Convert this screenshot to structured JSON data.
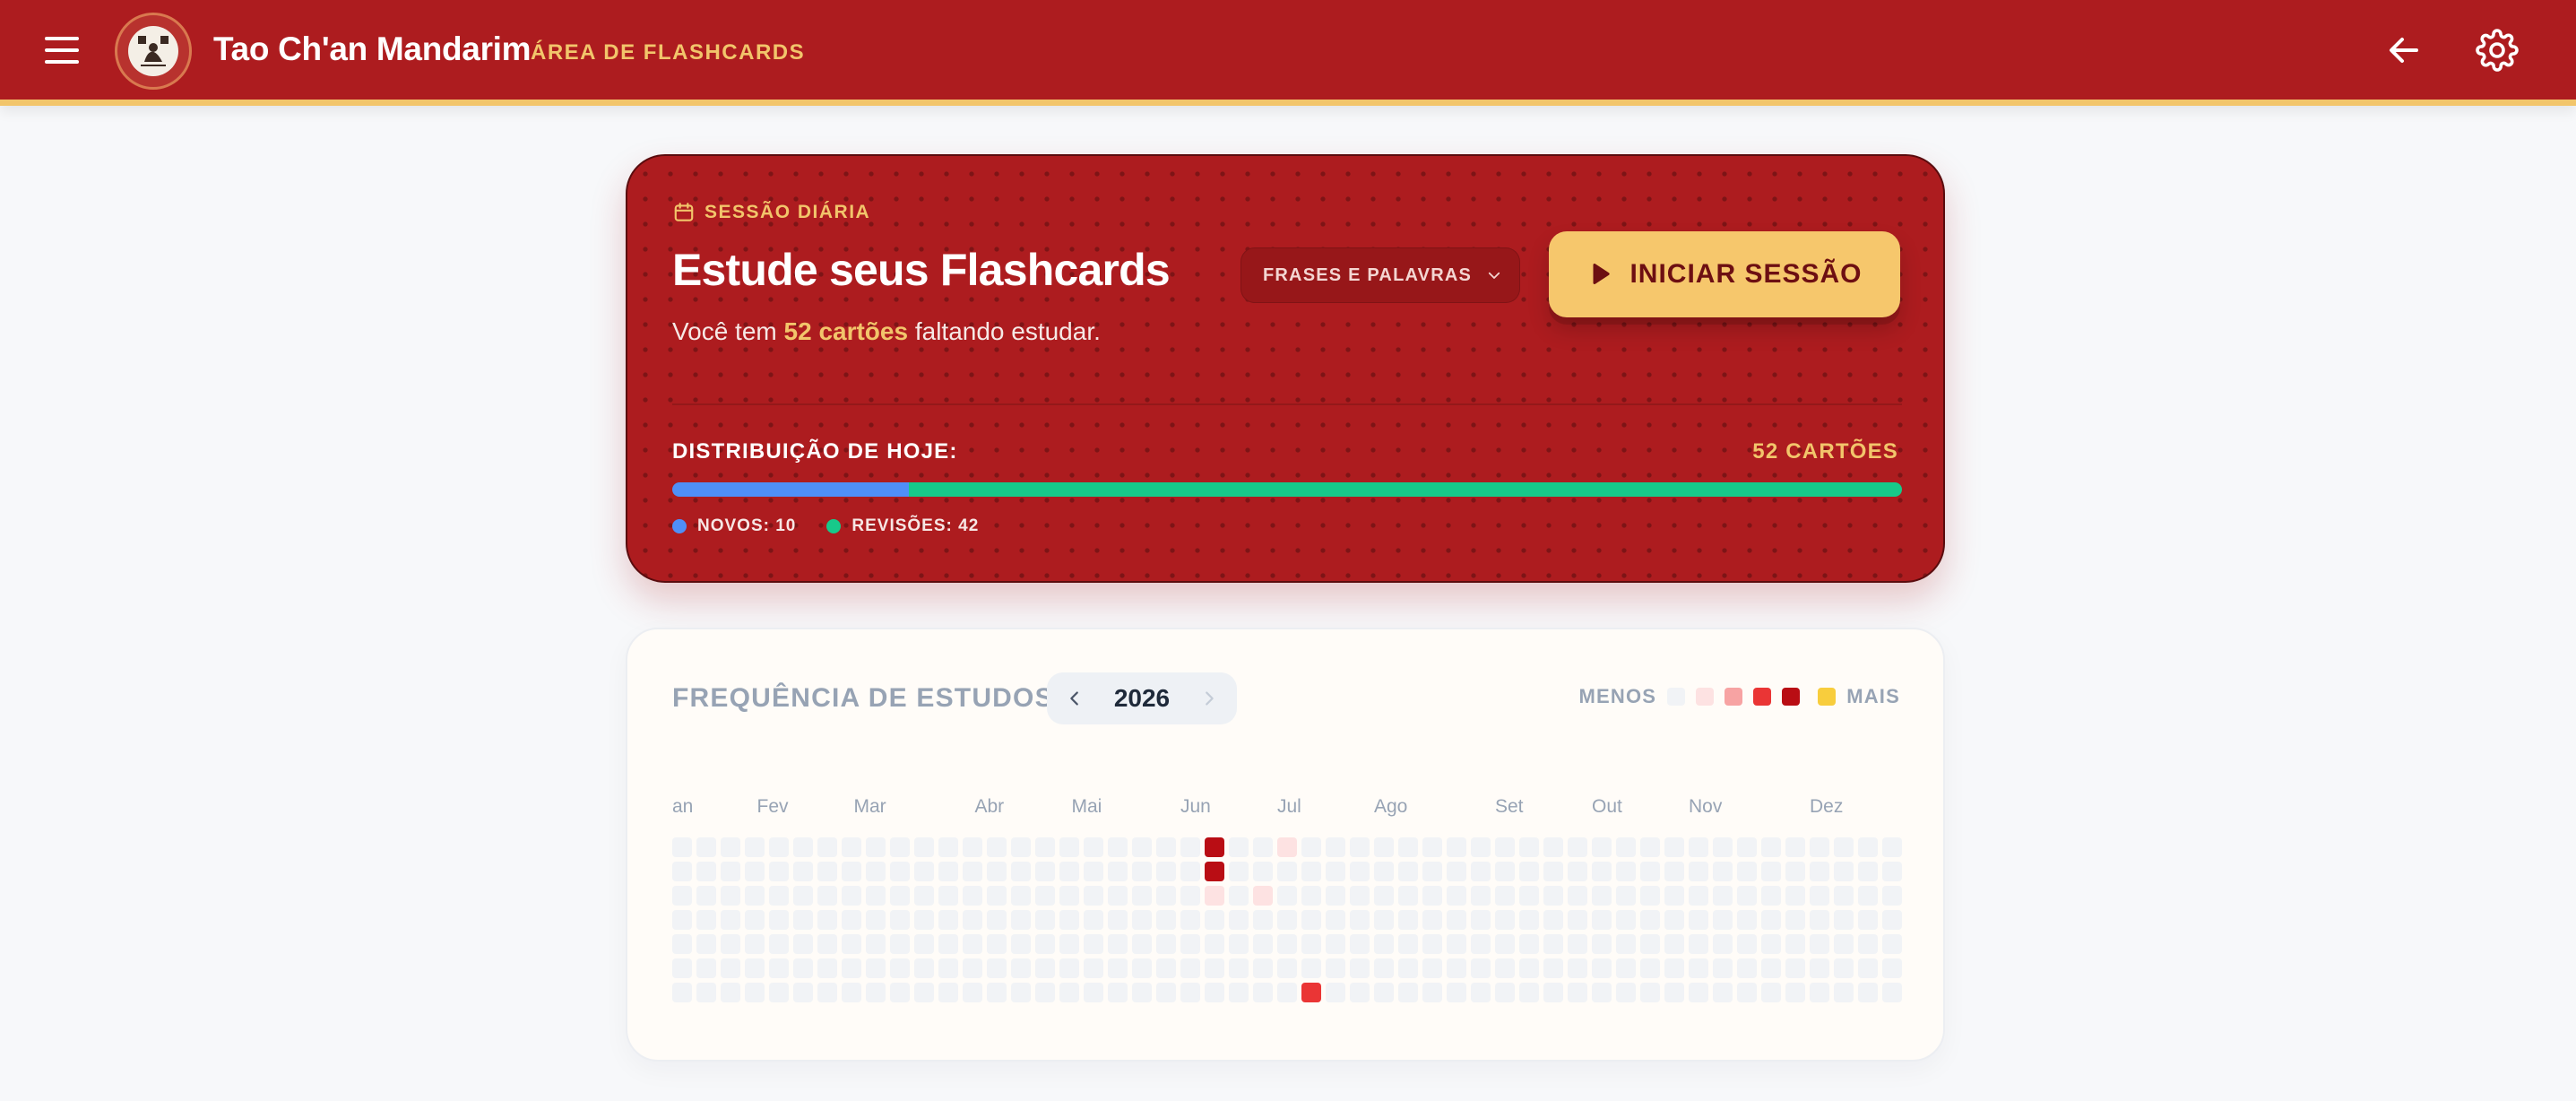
{
  "header": {
    "app_title": "Tao Ch'an Mandarim",
    "section_label": "ÁREA DE FLASHCARDS",
    "colors": {
      "bar": "#ad1c1f",
      "accent": "#f2c56b"
    }
  },
  "session": {
    "kicker": "SESSÃO DIÁRIA",
    "title": "Estude seus Flashcards",
    "sub_prefix": "Você tem ",
    "sub_highlight": "52 cartões",
    "sub_suffix": " faltando estudar.",
    "deck_select_value": "FRASES E PALAVRAS",
    "start_label": "INICIAR SESSÃO",
    "dist_label": "DISTRIBUIÇÃO DE HOJE:",
    "dist_total": "52 CARTÕES",
    "new_count": 10,
    "review_count": 42,
    "legend_new": "NOVOS: 10",
    "legend_review": "REVISÕES: 42",
    "colors": {
      "new": "#4f8ff7",
      "review": "#17c98a"
    }
  },
  "frequency": {
    "title": "FREQUÊNCIA DE ESTUDOS",
    "year": "2026",
    "scale_less": "MENOS",
    "scale_more": "MAIS",
    "scale_colors": [
      "#f1f3f6",
      "#fde2e2",
      "#f7a3a3",
      "#ea3535",
      "#b90d14",
      "#f8cd3d"
    ],
    "months": [
      "an",
      "Fev",
      "Mar",
      "Abr",
      "Mai",
      "Jun",
      "Jul",
      "Ago",
      "Set",
      "Out",
      "Nov",
      "Dez"
    ],
    "weeks": 51,
    "active_days": [
      {
        "week": 22,
        "day": 0,
        "level": 4
      },
      {
        "week": 22,
        "day": 1,
        "level": 4
      },
      {
        "week": 22,
        "day": 2,
        "level": 1
      },
      {
        "week": 24,
        "day": 2,
        "level": 1
      },
      {
        "week": 25,
        "day": 0,
        "level": 1
      },
      {
        "week": 26,
        "day": 6,
        "level": 3
      }
    ]
  }
}
